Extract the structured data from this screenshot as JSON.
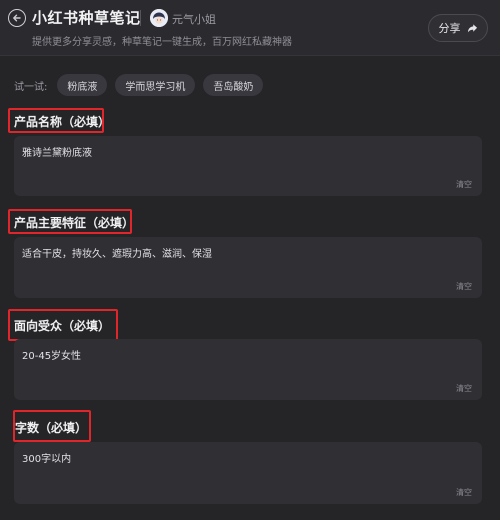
{
  "header": {
    "title": "小红书种草笔记",
    "author": "元气小姐",
    "subtitle": "提供更多分享灵感，种草笔记一键生成，百万网红私藏神器",
    "share_label": "分享"
  },
  "try": {
    "label": "试一试:",
    "chips": [
      "粉底液",
      "学而思学习机",
      "吾岛酸奶"
    ]
  },
  "fields": [
    {
      "label": "产品名称（必填）",
      "value": "雅诗兰黛粉底液",
      "clear": "清空"
    },
    {
      "label": "产品主要特征（必填）",
      "value": "适合干皮，持妆久、遮瑕力高、滋润、保湿",
      "clear": "清空"
    },
    {
      "label": "面向受众（必填）",
      "value": "20-45岁女性",
      "clear": "清空"
    },
    {
      "label": "字数（必填）",
      "value": "300字以内",
      "clear": "清空"
    }
  ],
  "colors": {
    "background": "#252528",
    "field_bg": "#2f2f34",
    "highlight": "#e0262b"
  }
}
